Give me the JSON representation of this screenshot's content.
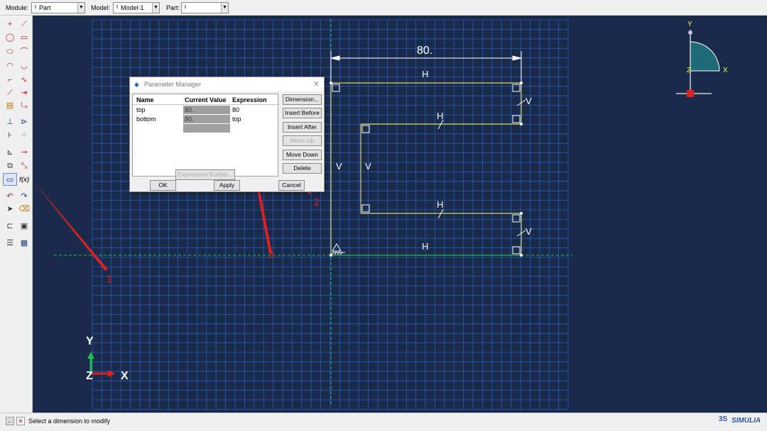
{
  "topbar": {
    "module_label": "Module:",
    "module_value": "Part",
    "model_label": "Model:",
    "model_value": "Model-1",
    "part_label": "Part:",
    "part_value": ""
  },
  "dialog": {
    "title": "Parameter Manager",
    "columns": [
      "Name",
      "Current Value",
      "Expression"
    ],
    "rows": [
      {
        "name": "top",
        "current_value": "80.",
        "expression": "80"
      },
      {
        "name": "bottom",
        "current_value": "80.",
        "expression": "top"
      },
      {
        "name": "",
        "current_value": "",
        "expression": ""
      }
    ],
    "side_buttons": [
      "Dimension...",
      "Insert Before",
      "Insert After",
      "Move Up",
      "Move Down",
      "Delete"
    ],
    "expression_builder": "Expression Builder...",
    "ok": "OK",
    "apply": "Apply",
    "cancel": "Cancel"
  },
  "sketch": {
    "dimension_value": "80.",
    "labels": [
      "H",
      "H",
      "H",
      "H",
      "V",
      "V",
      "V",
      "V"
    ]
  },
  "triad": {
    "x": "X",
    "y": "Y",
    "z": "Z"
  },
  "view_triad": {
    "x": "X",
    "y": "Y",
    "z": "Z"
  },
  "annotations": [
    "1",
    "2",
    "3"
  ],
  "toolbox": {
    "fx_label": "f(x)"
  },
  "status": {
    "prompt": "Select a dimension to modify",
    "brand": "SIMULIA",
    "brand_mark": "3S"
  },
  "colors": {
    "viewport_bg": "#1a2a4a",
    "grid": "#2b5cb8",
    "sketch_line": "#d8d860",
    "construction": "#20c050",
    "annotation": "#e02020"
  }
}
